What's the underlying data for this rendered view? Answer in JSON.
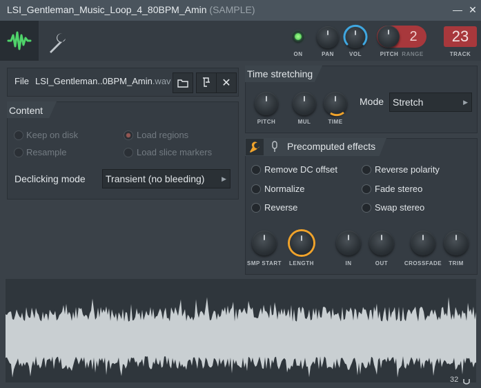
{
  "window": {
    "title": "LSI_Gentleman_Music_Loop_4_80BPM_Amin",
    "subtitle": "(SAMPLE)"
  },
  "toolbar": {
    "on_label": "ON",
    "pan_label": "PAN",
    "vol_label": "VOL",
    "pitch_label": "PITCH",
    "range_label": "RANGE",
    "range_value": "2",
    "track_label": "TRACK",
    "track_value": "23"
  },
  "file": {
    "label": "File",
    "name": "LSI_Gentleman..0BPM_Amin",
    "ext": ".wav"
  },
  "content": {
    "header": "Content",
    "options": [
      {
        "label": "Keep on disk"
      },
      {
        "label": "Load regions"
      },
      {
        "label": "Resample"
      },
      {
        "label": "Load slice markers"
      }
    ],
    "declicking_label": "Declicking mode",
    "declicking_value": "Transient (no bleeding)"
  },
  "time_stretching": {
    "header": "Time stretching",
    "knobs": [
      "PITCH",
      "MUL",
      "TIME"
    ],
    "mode_label": "Mode",
    "mode_value": "Stretch"
  },
  "precomputed": {
    "header": "Precomputed effects",
    "options": [
      {
        "label": "Remove DC offset"
      },
      {
        "label": "Reverse polarity"
      },
      {
        "label": "Normalize"
      },
      {
        "label": "Fade stereo"
      },
      {
        "label": "Reverse"
      },
      {
        "label": "Swap stereo"
      }
    ],
    "knobs": [
      "SMP START",
      "LENGTH",
      "IN",
      "OUT",
      "CROSSFADE",
      "TRIM"
    ]
  },
  "waveform": {
    "footer_value": "32"
  },
  "colors": {
    "accent_green": "#4fd36a",
    "accent_orange": "#f0a32b",
    "accent_blue": "#3fa7e0",
    "range_red": "#a8383c",
    "waveform": "#c9cfd2"
  }
}
